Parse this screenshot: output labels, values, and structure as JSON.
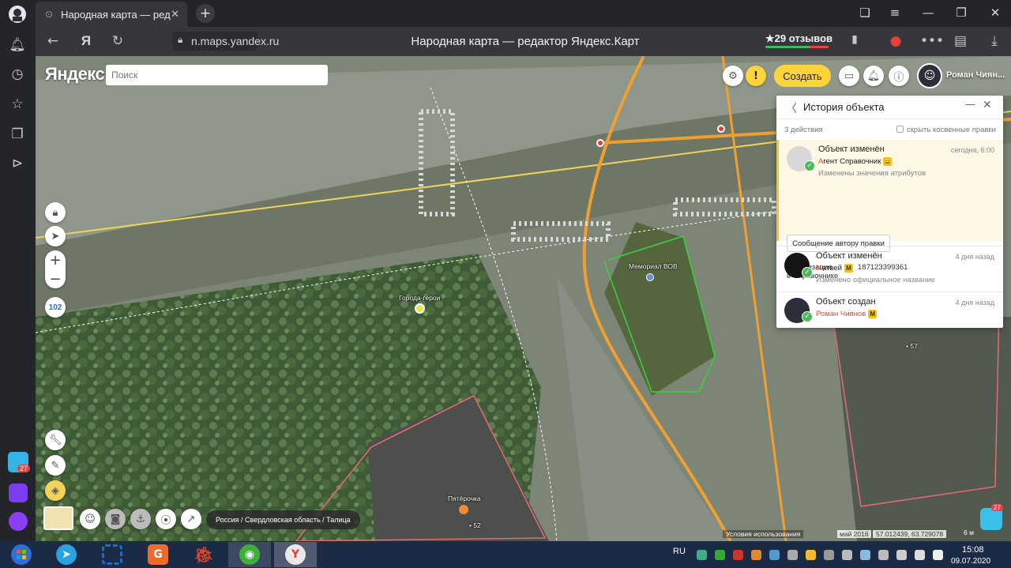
{
  "browser": {
    "tab_title": "Народная карта — ред",
    "url": "n.maps.yandex.ru",
    "page_title": "Народная карта — редактор Яндекс.Карт",
    "reviews": "★29 отзывов",
    "browser_logo": "Я",
    "sidebar_badge": "27"
  },
  "map": {
    "logo": "Яндекс",
    "search_placeholder": "Поиск",
    "zoom_level": "102",
    "create_button": "Создать",
    "user_name": "Роман Чиян...",
    "labels": {
      "memorial": "Мемориал ВОВ",
      "heroes": "Города-герои",
      "shop": "Пятёрочка",
      "house_52": "• 52",
      "house_57": "• 57"
    },
    "breadcrumb": "Россия / Свердловская область / Талица",
    "copyright": "Условия использования",
    "imagery_date": "май 2016",
    "coordinates": "57.012439, 63.729078",
    "scale": "6 м",
    "notif_badge": "27"
  },
  "history_panel": {
    "title": "История объекта",
    "actions_count": "3 действия",
    "hide_indirect": "скрыть косвенные правки",
    "message_button": "Сообщение автору правки",
    "attr_label_line1": "Организация",
    "attr_label_line2": "в Справочнике",
    "attr_value": "187123399361",
    "entries": [
      {
        "title": "Объект изменён",
        "time": "сегодня, 6:00",
        "user_first": "А",
        "user_rest": "гент Справочник",
        "badge": "😀",
        "desc": "Изменены значения атрибутов"
      },
      {
        "title": "Объект изменён",
        "time": "4 дня назад",
        "user_first": "М",
        "user_rest": "атвей",
        "badge": "M",
        "desc": "Изменено официальное название"
      },
      {
        "title": "Объект создан",
        "time": "4 дня назад",
        "user_first": "",
        "user_rest": "Роман Чиянов",
        "badge": "M",
        "desc": ""
      }
    ]
  },
  "taskbar": {
    "lang": "RU",
    "time": "15:08",
    "date": "09.07.2020",
    "colors": {
      "telegram": "#2aa3df",
      "snip": "#1f6bd6",
      "pdf": "#f06a2b",
      "yandex": "#e8e8e8"
    }
  }
}
